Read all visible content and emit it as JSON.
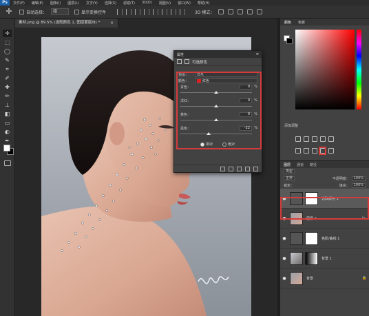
{
  "menubar": {
    "logo": "Ps",
    "items": [
      "文件(F)",
      "编辑(E)",
      "图像(I)",
      "图层(L)",
      "文字(Y)",
      "选择(S)",
      "滤镜(T)",
      "3D(D)",
      "视图(V)",
      "窗口(W)",
      "帮助(H)"
    ]
  },
  "options": {
    "auto_select": "自动选择：",
    "auto_select_value": "组",
    "show_transform": "显示变换控件",
    "mode3d": "3D 模式："
  },
  "document_tab": {
    "title": "素材.png @ 89.5% (选取颜色 1, 图层蒙版/8) *",
    "close": "×"
  },
  "properties": {
    "panel_title": "属性",
    "panel_menu": "≡",
    "adjustment_title": "可选颜色",
    "preset_label": "预设：",
    "preset_value": "自定",
    "colors_label": "颜色：",
    "colors_value": "红色",
    "sliders": [
      {
        "label": "青色：",
        "value": "0",
        "unit": "%",
        "fraction": 0.5
      },
      {
        "label": "洋红：",
        "value": "0",
        "unit": "%",
        "fraction": 0.5
      },
      {
        "label": "黄色：",
        "value": "0",
        "unit": "%",
        "fraction": 0.5
      },
      {
        "label": "黑色：",
        "value": "-22",
        "unit": "%",
        "fraction": 0.39
      }
    ],
    "method_relative": "相对",
    "method_absolute": "绝对"
  },
  "color_panel": {
    "tabs": [
      "颜色",
      "色板"
    ],
    "colors": {
      "hue_pure": "#ff0000"
    }
  },
  "adjustments": {
    "title": "添加调整"
  },
  "layers_panel": {
    "tabs": [
      "图层",
      "通道",
      "路径"
    ],
    "kind_label": "类型",
    "blend_mode": "正常",
    "opacity_label": "不透明度：",
    "opacity_value": "100%",
    "lock_label": "锁定：",
    "fill_label": "填充：",
    "fill_value": "100%",
    "layers": [
      {
        "name": "选取颜色 1",
        "type": "adjustment",
        "selected": true
      },
      {
        "name": "图层 2",
        "type": "image",
        "fx": "fx"
      },
      {
        "name": "色阶/曲线 1",
        "type": "adjustment"
      },
      {
        "name": "背景 1",
        "type": "image"
      },
      {
        "name": "背景",
        "type": "image",
        "locked": "🔒"
      }
    ]
  }
}
